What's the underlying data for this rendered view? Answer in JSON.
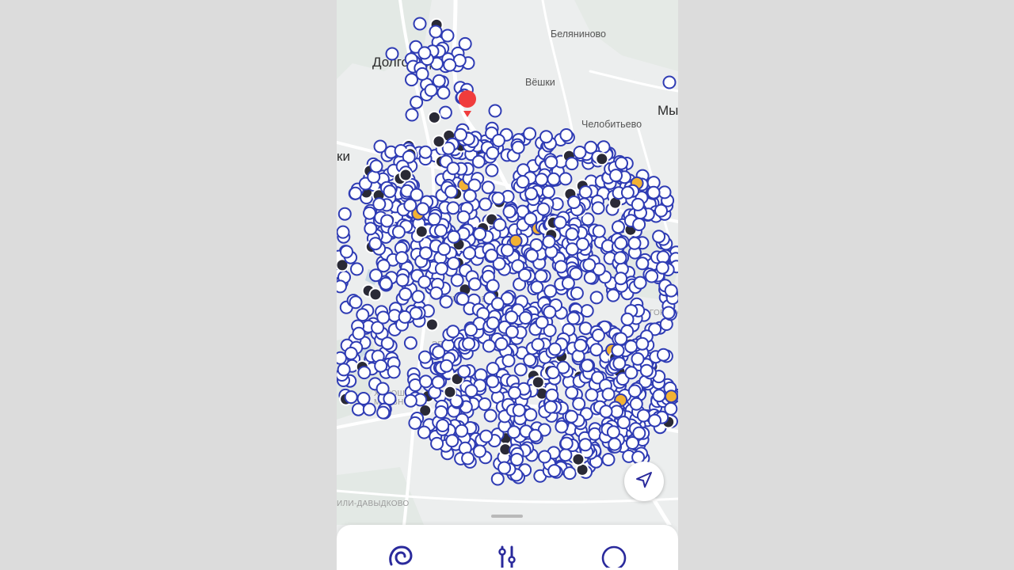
{
  "map": {
    "labels": {
      "dolgoprudny": "Долгопрудный",
      "belyaninovo": "Беляниново",
      "vyoshki": "Вёшки",
      "chelobityevo": "Челобитьево",
      "mytishchi_partial": "Мы",
      "left_partial": "ки",
      "timiryazevsky": "ТИМИРЯЗЕВСК",
      "bogorodskoye": "БОГОРОДСК",
      "khoroshevo": "ХОРОШЕВ",
      "mnevniki": "МНЁВН",
      "davydkovo": "ИЛИ-ДАВЫДКОВО",
      "airport": "ЭРОПОРТ"
    },
    "colors": {
      "background": "#eceeee",
      "park": "#dfe6e2",
      "road": "#ffffff",
      "marker_ring": "#2f3cb4",
      "marker_fill": "#ffffff",
      "marker_dark": "#2a2a36",
      "marker_yellow": "#f2b233",
      "pin": "#f03c3c"
    },
    "user_pin": "red-location-pin"
  },
  "controls": {
    "locate_icon": "navigation-arrow-icon"
  },
  "bottom_nav": {
    "items": [
      {
        "icon": "scooter-logo-icon"
      },
      {
        "icon": "filters-icon"
      },
      {
        "icon": "circle-icon"
      }
    ],
    "accent": "#2a2a9c"
  }
}
